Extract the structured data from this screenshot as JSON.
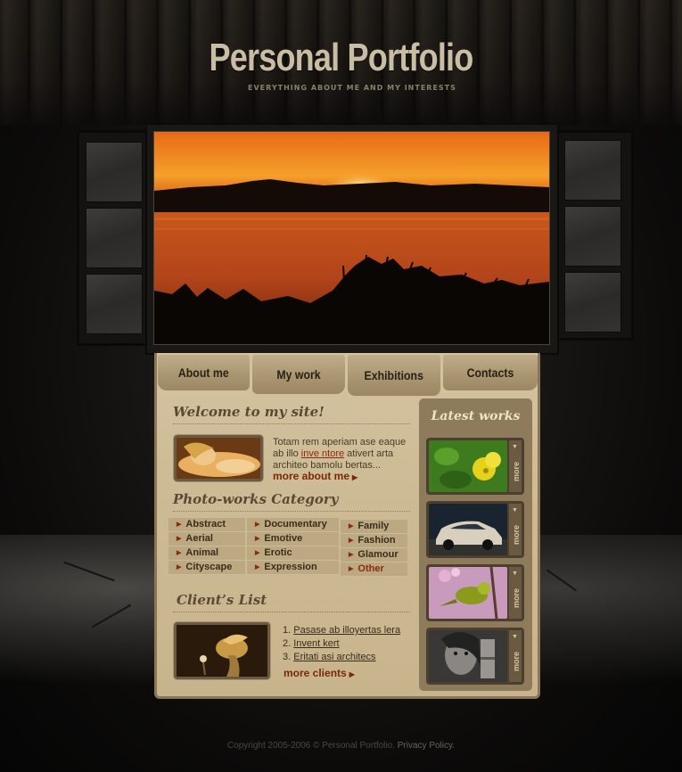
{
  "header": {
    "title": "Personal Portfolio",
    "subtitle": "EVERYTHING ABOUT ME AND MY INTERESTS"
  },
  "nav": {
    "tabs": [
      {
        "label": "About me"
      },
      {
        "label": "My work"
      },
      {
        "label": "Exhibitions"
      },
      {
        "label": "Contacts"
      }
    ]
  },
  "welcome": {
    "heading": "Welcome to my site!",
    "text_before": "Totam rem aperiam ase eaque ab illo ",
    "link_text": "inve ntore",
    "text_after": " ativert arta architeo bamolu bertas...",
    "more_label": "more about me"
  },
  "categories": {
    "heading": "Photo-works Category",
    "columns": [
      [
        "Abstract",
        "Aerial",
        "Animal",
        "Cityscape"
      ],
      [
        "Documentary",
        "Emotive",
        "Erotic",
        "Expression"
      ],
      [
        "Family",
        "Fashion",
        "Glamour",
        "Other"
      ]
    ]
  },
  "clients": {
    "heading": "Client’s List",
    "items": [
      {
        "num": "1.",
        "label": "Pasase ab illoyertas lera"
      },
      {
        "num": "2.",
        "label": "Invent kert"
      },
      {
        "num": "3.",
        "label": "Eritati asi architecs"
      }
    ],
    "more_label": "more clients"
  },
  "latest": {
    "heading": "Latest works",
    "more_label": "more",
    "items": [
      {
        "subject": "flower"
      },
      {
        "subject": "car"
      },
      {
        "subject": "bird"
      },
      {
        "subject": "portrait"
      }
    ]
  },
  "footer": {
    "copyright": "Copyright 2005-2006 © Personal Portfolio.",
    "privacy": "Privacy Policy."
  },
  "colors": {
    "panel": "#d4c3a0",
    "accent_link": "#8a2a10",
    "tab": "#a8946f"
  }
}
